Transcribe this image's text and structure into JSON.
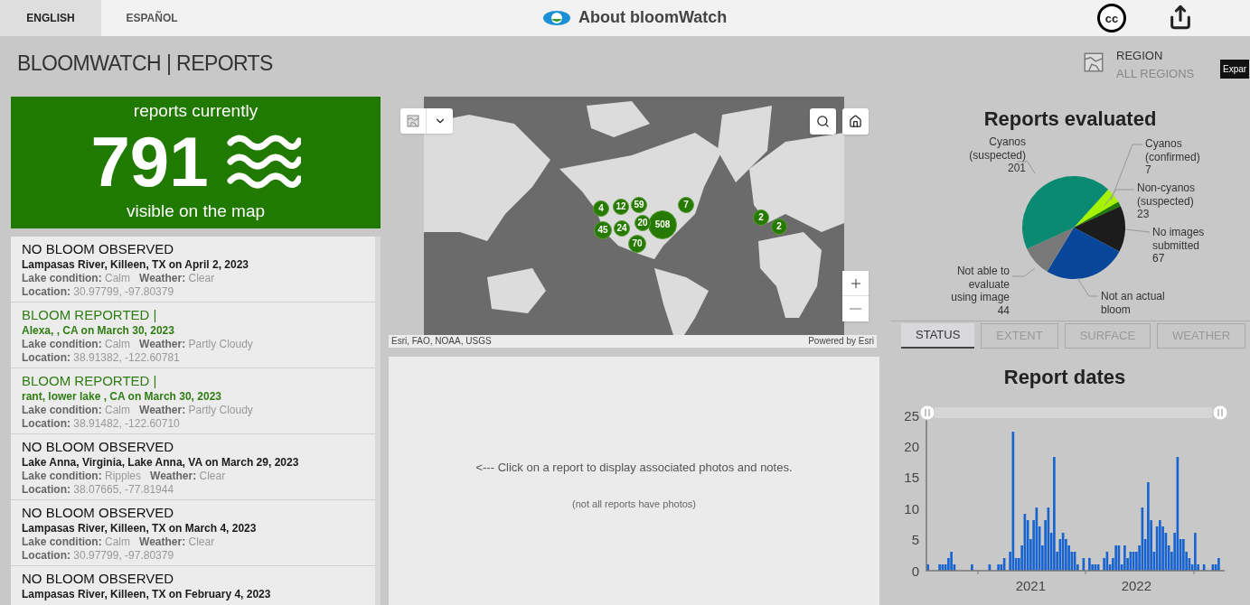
{
  "top_bar": {
    "languages": [
      {
        "label": "ENGLISH",
        "selected": true
      },
      {
        "label": "ESPAÑOL",
        "selected": false
      }
    ],
    "about_link": "About bloomWatch",
    "cc_label": "cc"
  },
  "header": {
    "title": "BLOOMWATCH | REPORTS",
    "region_label": "REGION",
    "region_value": "ALL REGIONS",
    "tooltip": "Expar"
  },
  "summary": {
    "top_text": "reports currently",
    "count": "791",
    "bottom_text": "visible on the map"
  },
  "reports": [
    {
      "kind": "no_bloom",
      "title": "NO BLOOM OBSERVED",
      "place": "Lampasas River, Killeen, TX on April 2, 2023",
      "conditions": "**Lake condition:** Calm   **Weather:** Clear",
      "location": "**Location:** 30.97799, -97.80379"
    },
    {
      "kind": "bloom",
      "title": "BLOOM REPORTED |",
      "place": "Alexa, , CA on March 30, 2023",
      "conditions": "**Lake condition:** Calm   **Weather:** Partly Cloudy",
      "location": "**Location:** 38.91382, -122.60781"
    },
    {
      "kind": "bloom",
      "title": "BLOOM REPORTED |",
      "place": "rant, lower lake , CA on March 30, 2023",
      "conditions": "**Lake condition:** Calm   **Weather:** Partly Cloudy",
      "location": "**Location:** 38.91482, -122.60710"
    },
    {
      "kind": "no_bloom",
      "title": "NO BLOOM OBSERVED",
      "place": "Lake Anna, Virginia, Lake Anna, VA on March 29, 2023",
      "conditions": "**Lake condition:** Ripples   **Weather:** Clear",
      "location": "**Location:** 38.07665, -77.81944"
    },
    {
      "kind": "no_bloom",
      "title": "NO BLOOM OBSERVED",
      "place": "Lampasas River, Killeen, TX on March 4, 2023",
      "conditions": "**Lake condition:** Calm   **Weather:** Clear",
      "location": "**Location:** 30.97799, -97.80379"
    },
    {
      "kind": "no_bloom",
      "title": "NO BLOOM OBSERVED",
      "place": "Lampasas River, Killeen, TX on February 4, 2023"
    }
  ],
  "map": {
    "clusters": [
      {
        "count": "508"
      },
      {
        "count": "4"
      },
      {
        "count": "45"
      },
      {
        "count": "24"
      },
      {
        "count": "70"
      },
      {
        "count": "20"
      },
      {
        "count": "12"
      },
      {
        "count": "59"
      },
      {
        "count": "7"
      },
      {
        "count": "2"
      },
      {
        "count": "2"
      }
    ],
    "attribution": "Esri, FAO, NOAA, USGS",
    "powered_by": "Powered by Esri"
  },
  "photos": {
    "hint": "<--- Click on a report to display associated photos and notes.",
    "note": "(not all reports have photos)"
  },
  "evaluation": {
    "chart_data": {
      "type": "pie",
      "title": "Reports evaluated",
      "categories": [
        "Non-cyanos (suspected)",
        "Cyanos (confirmed)",
        "No images submitted",
        "Not an actual bloom",
        "Not able to evaluate using image",
        "Cyanos (suspected)"
      ],
      "values": [
        23,
        7,
        67,
        120,
        44,
        201
      ],
      "colors": [
        "#a6f300",
        "#1f7a00",
        "#1c1c1c",
        "#08469a",
        "#787878",
        "#0a8a70"
      ],
      "value_labels": [
        "23",
        "7",
        "67",
        null,
        "44",
        "201"
      ]
    }
  },
  "tabs": [
    {
      "label": "STATUS",
      "selected": true
    },
    {
      "label": "EXTENT",
      "selected": false
    },
    {
      "label": "SURFACE",
      "selected": false
    },
    {
      "label": "WEATHER",
      "selected": false
    }
  ],
  "dates": {
    "chart_data": {
      "type": "bar",
      "title": "Report dates",
      "ylim": [
        0,
        25
      ],
      "yticks": [
        0,
        5,
        10,
        15,
        20,
        25
      ],
      "color": "#1764d0",
      "categories": [
        null,
        null,
        null,
        null,
        null,
        null,
        null,
        null,
        null,
        null,
        null,
        null,
        null,
        null,
        null,
        null,
        null,
        null,
        null,
        null,
        null,
        null,
        null,
        null,
        null,
        null,
        null,
        null,
        null,
        null,
        null,
        null,
        null,
        null,
        null,
        "2021",
        null,
        null,
        null,
        null,
        null,
        null,
        null,
        null,
        null,
        null,
        null,
        null,
        null,
        null,
        null,
        null,
        null,
        null,
        null,
        null,
        null,
        null,
        null,
        null,
        null,
        null,
        null,
        null,
        null,
        null,
        null,
        null,
        null,
        null,
        null,
        "2022",
        null,
        null,
        null,
        null,
        null,
        null,
        null,
        null,
        null,
        null,
        null,
        null,
        null,
        null,
        null,
        null,
        null,
        null,
        null,
        null,
        null,
        null,
        null,
        null,
        null,
        null,
        null,
        null
      ],
      "values": [
        1,
        0,
        0,
        0,
        1,
        1,
        1,
        2,
        3,
        1,
        0,
        0,
        0,
        0,
        0,
        1,
        0,
        0,
        0,
        0,
        0,
        1,
        0,
        0,
        1,
        1,
        2,
        0,
        3,
        22,
        2,
        2,
        4,
        9,
        8,
        5,
        8,
        10,
        7,
        4,
        8,
        10,
        6,
        18,
        3,
        5,
        6,
        5,
        4,
        3,
        3,
        1,
        0,
        2,
        0,
        2,
        1,
        1,
        1,
        0,
        2,
        3,
        1,
        2,
        4,
        4,
        1,
        4,
        2,
        3,
        3,
        3,
        4,
        10,
        5,
        14,
        8,
        3,
        7,
        8,
        7,
        6,
        4,
        3,
        6,
        18,
        5,
        5,
        3,
        2,
        1,
        6,
        1,
        0,
        1,
        0,
        0,
        1,
        1,
        2
      ]
    }
  }
}
